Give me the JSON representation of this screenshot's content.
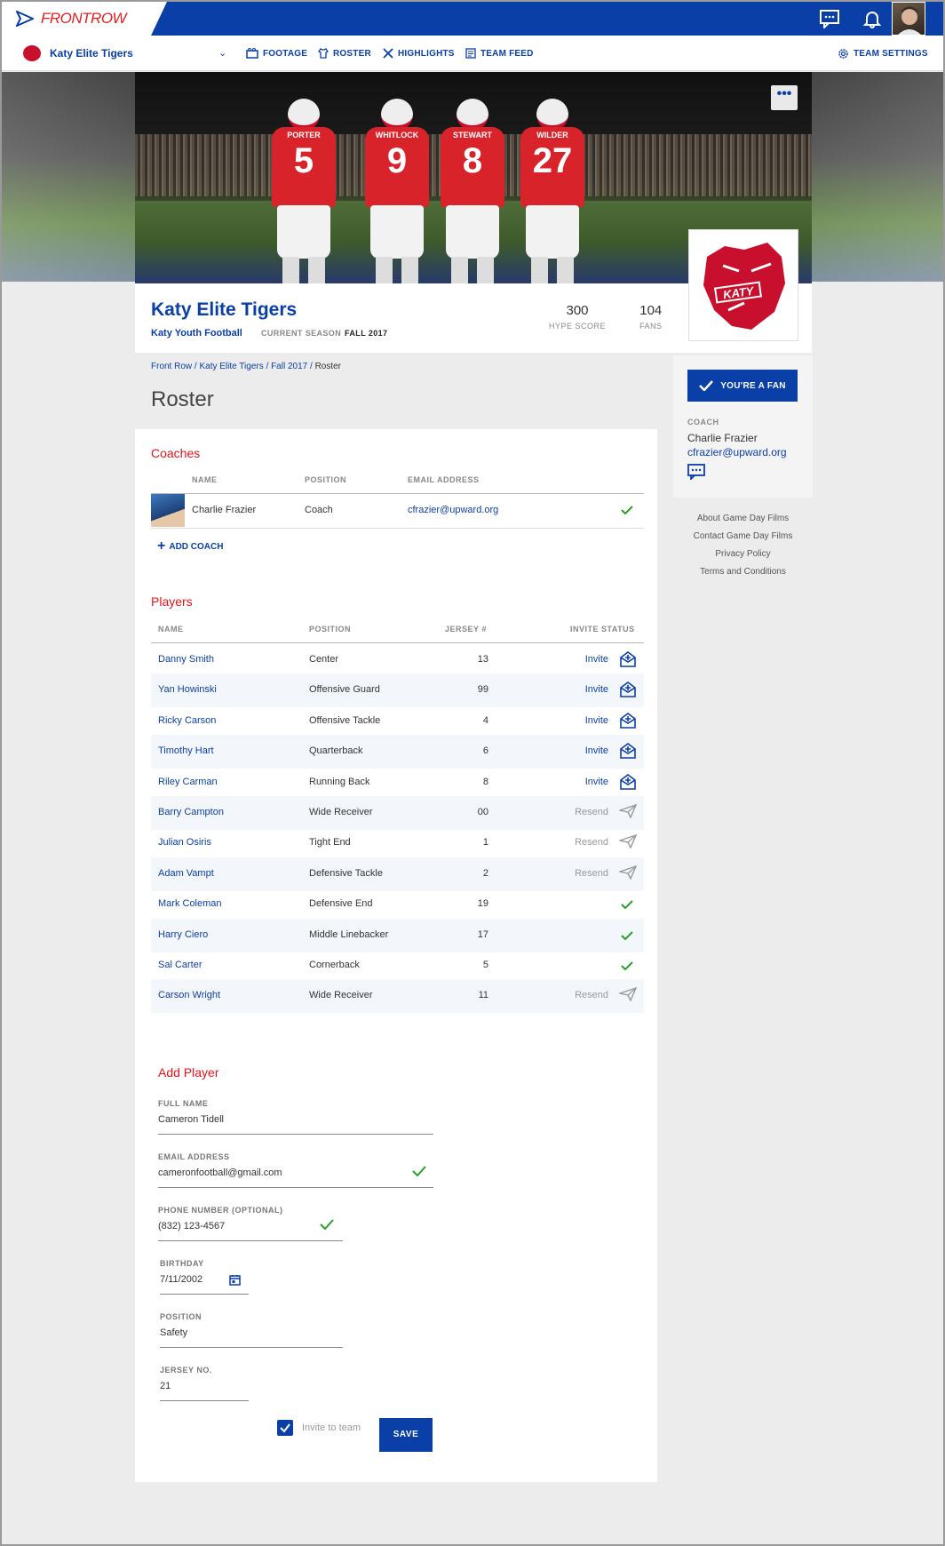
{
  "app": {
    "logo_front": "FRONT",
    "logo_row": "ROW"
  },
  "nav": {
    "team": "Katy Elite Tigers",
    "items": [
      {
        "label": "FOOTAGE"
      },
      {
        "label": "ROSTER"
      },
      {
        "label": "HIGHLIGHTS"
      },
      {
        "label": "TEAM FEED"
      }
    ],
    "settings": "TEAM SETTINGS"
  },
  "hero": {
    "players": [
      {
        "name": "PORTER",
        "num": "5"
      },
      {
        "name": "WHITLOCK",
        "num": "9"
      },
      {
        "name": "STEWART",
        "num": "8"
      },
      {
        "name": "WILDER",
        "num": "27"
      }
    ],
    "more": "•••",
    "logo_text": "KATY"
  },
  "header": {
    "title": "Katy Elite Tigers",
    "subtitle": "Katy Youth Football",
    "season_label": "CURRENT SEASON",
    "season_value": "FALL 2017",
    "hype_value": "300",
    "hype_label": "HYPE SCORE",
    "fans_value": "104",
    "fans_label": "FANS"
  },
  "breadcrumb": {
    "items": [
      "Front Row",
      "Katy Elite Tigers",
      "Fall 2017"
    ],
    "current": "Roster"
  },
  "page_title": "Roster",
  "coaches": {
    "title": "Coaches",
    "headers": [
      "NAME",
      "POSITION",
      "EMAIL ADDRESS"
    ],
    "rows": [
      {
        "name": "Charlie Frazier",
        "position": "Coach",
        "email": "cfrazier@upward.org"
      }
    ],
    "add_label": "ADD COACH"
  },
  "players": {
    "title": "Players",
    "headers": [
      "NAME",
      "POSITION",
      "JERSEY #",
      "INVITE STATUS"
    ],
    "rows": [
      {
        "name": "Danny Smith",
        "position": "Center",
        "jersey": "13",
        "status": "Invite"
      },
      {
        "name": "Yan Howinski",
        "position": "Offensive Guard",
        "jersey": "99",
        "status": "Invite"
      },
      {
        "name": "Ricky Carson",
        "position": "Offensive Tackle",
        "jersey": "4",
        "status": "Invite"
      },
      {
        "name": "Timothy Hart",
        "position": "Quarterback",
        "jersey": "6",
        "status": "Invite"
      },
      {
        "name": "Riley Carman",
        "position": "Running Back",
        "jersey": "8",
        "status": "Invite"
      },
      {
        "name": "Barry Campton",
        "position": "Wide Receiver",
        "jersey": "00",
        "status": "Resend"
      },
      {
        "name": "Julian Osiris",
        "position": "Tight End",
        "jersey": "1",
        "status": "Resend"
      },
      {
        "name": "Adam Vampt",
        "position": "Defensive Tackle",
        "jersey": "2",
        "status": "Resend"
      },
      {
        "name": "Mark Coleman",
        "position": "Defensive End",
        "jersey": "19",
        "status": "accepted"
      },
      {
        "name": "Harry Ciero",
        "position": "Middle Linebacker",
        "jersey": "17",
        "status": "accepted"
      },
      {
        "name": "Sal Carter",
        "position": "Cornerback",
        "jersey": "5",
        "status": "accepted"
      },
      {
        "name": "Carson Wright",
        "position": "Wide Receiver",
        "jersey": "11",
        "status": "Resend"
      }
    ]
  },
  "add_player": {
    "title": "Add Player",
    "full_name_label": "FULL NAME",
    "full_name": "Cameron Tidell",
    "email_label": "EMAIL ADDRESS",
    "email": "cameronfootball@gmail.com",
    "phone_label": "PHONE NUMBER (OPTIONAL)",
    "phone": "(832) 123-4567",
    "birthday_label": "BIRTHDAY",
    "birthday": "7/11/2002",
    "position_label": "POSITION",
    "position": "Safety",
    "jersey_label": "JERSEY NO.",
    "jersey": "21",
    "invite_label": "Invite to team",
    "invite_checked": true,
    "save_label": "SAVE"
  },
  "sidebar": {
    "fan_button": "YOU'RE A FAN",
    "coach_label": "COACH",
    "coach_name": "Charlie Frazier",
    "coach_email": "cfrazier@upward.org"
  },
  "footer": {
    "links": [
      "About Game Day Films",
      "Contact Game Day Films",
      "Privacy Policy",
      "Terms and Conditions"
    ]
  },
  "colors": {
    "brand_blue": "#0a3fa8",
    "accent_red": "#e0141c",
    "success_green": "#2a9d2a"
  }
}
